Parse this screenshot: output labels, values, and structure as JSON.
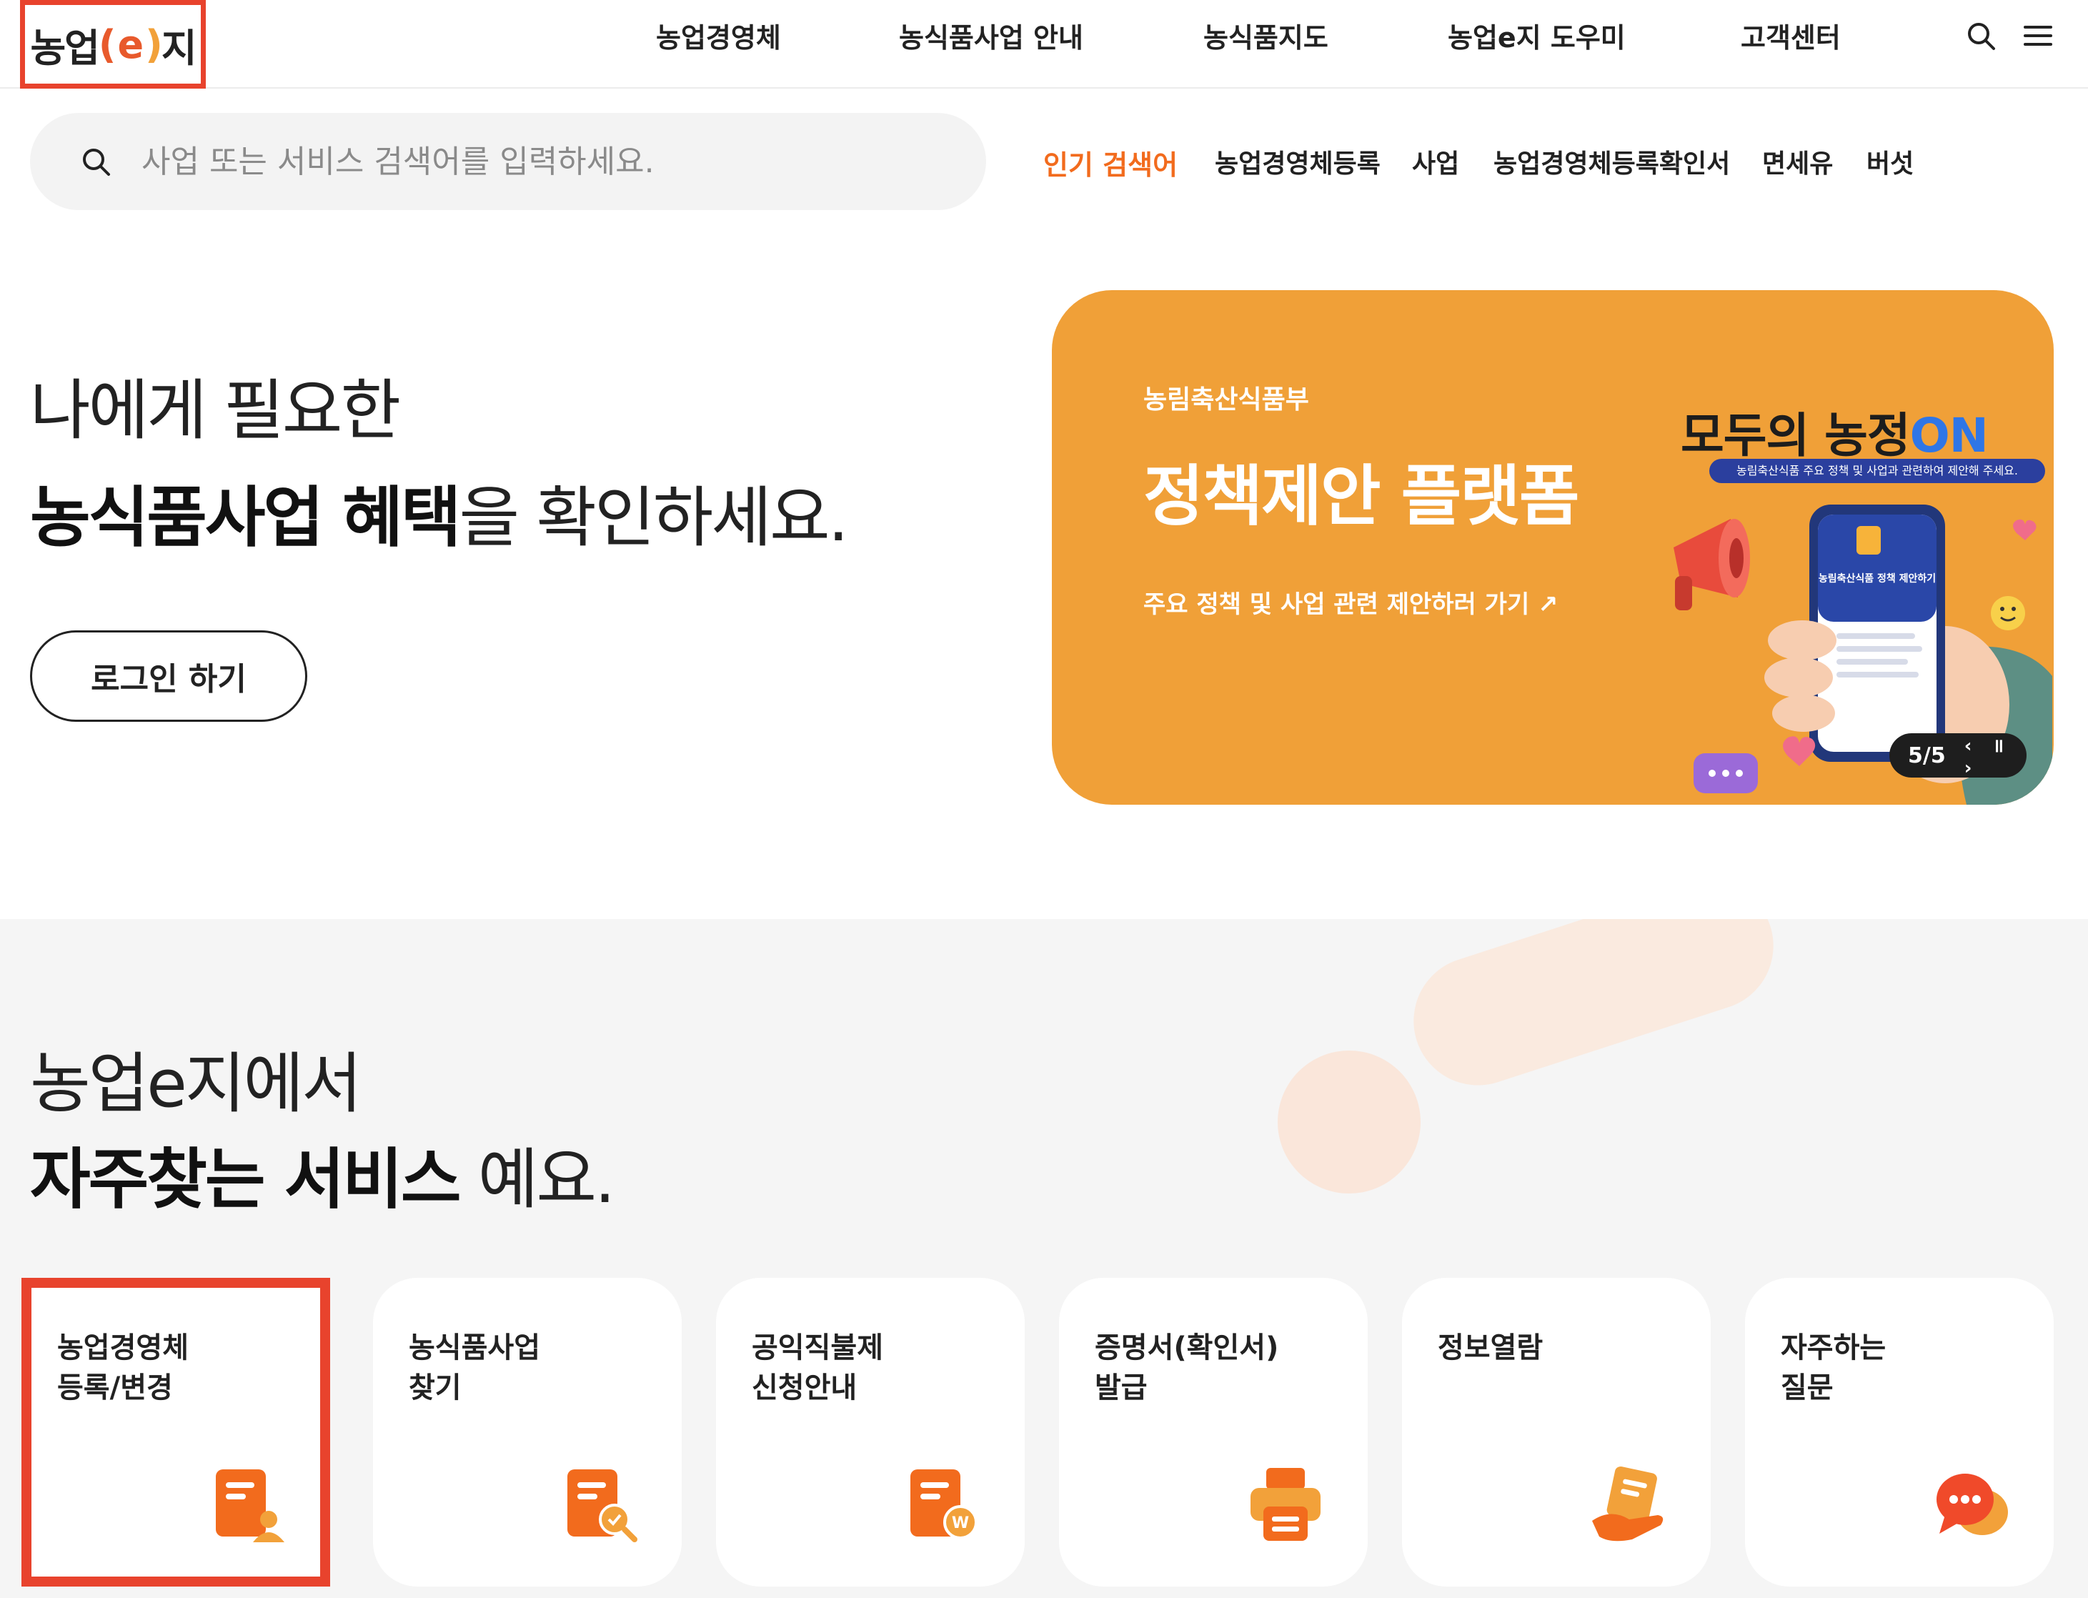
{
  "header": {
    "logo": {
      "part1": "농업",
      "paren_open": "(",
      "e": "e",
      "paren_close": ")",
      "part2": "지"
    },
    "nav": [
      "농업경영체",
      "농식품사업 안내",
      "농식품지도",
      "농업e지 도우미",
      "고객센터"
    ],
    "icons": [
      "search-icon",
      "menu-icon"
    ]
  },
  "search": {
    "placeholder": "사업 또는 서비스 검색어를 입력하세요.",
    "popular_label": "인기 검색어",
    "popular_keywords": [
      "농업경영체등록",
      "사업",
      "농업경영체등록확인서",
      "면세유",
      "버섯"
    ]
  },
  "hero": {
    "line1": "나에게 필요한",
    "line2_bold": "농식품사업 혜택",
    "line2_rest": "을 확인하세요.",
    "login_button": "로그인 하기"
  },
  "banner": {
    "org": "농림축산식품부",
    "title": "정책제안 플랫폼",
    "link": "주요 정책 및 사업 관련 제안하러 가기 ↗",
    "brand_main": "모두의 농정",
    "brand_on": "ON",
    "brand_sub": "농림축산식품 주요 정책 및 사업과 관련하여 제안해 주세요.",
    "phone_text": "농림축산식품 정책 제안하기",
    "pager": "5/5",
    "colors": {
      "background": "#f0a038",
      "on_accent": "#2f76e6",
      "strip": "#2b3f9e"
    }
  },
  "services": {
    "line1": "농업e지에서",
    "line2_bold": "자주찾는 서비스",
    "line2_rest": " 예요.",
    "cards": [
      {
        "line1": "농업경영체",
        "line2": "등록/변경",
        "icon": "document-person-icon"
      },
      {
        "line1": "농식품사업",
        "line2": "찾기",
        "icon": "document-search-icon"
      },
      {
        "line1": "공익직불제",
        "line2": "신청안내",
        "icon": "document-won-icon"
      },
      {
        "line1": "증명서(확인서)",
        "line2": "발급",
        "icon": "printer-icon"
      },
      {
        "line1": "정보열람",
        "line2": "",
        "icon": "hand-document-icon"
      },
      {
        "line1": "자주하는",
        "line2": "질문",
        "icon": "chat-bubble-icon"
      }
    ]
  },
  "theme": {
    "accent": "#f26b1d",
    "highlight_box": "#e8432d",
    "section_bg": "#f5f5f5"
  }
}
